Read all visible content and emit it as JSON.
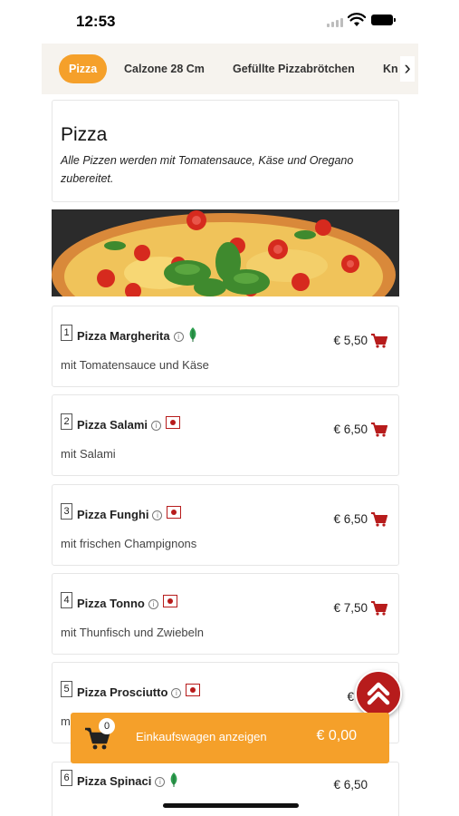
{
  "status_bar": {
    "time": "12:53"
  },
  "categories": {
    "items": [
      {
        "label": "Pizza",
        "active": true
      },
      {
        "label": "Calzone 28 Cm",
        "active": false
      },
      {
        "label": "Gefüllte Pizzabrötchen",
        "active": false
      },
      {
        "label": "Kn",
        "active": false
      }
    ]
  },
  "section": {
    "title": "Pizza",
    "description": "Alle Pizzen werden mit Tomatensauce, Käse und Oregano zubereitet."
  },
  "items": [
    {
      "number": "1",
      "name": "Pizza Margherita",
      "info": "i",
      "diet": "vegetarian",
      "price": "€ 5,50",
      "description": "mit Tomatensauce und Käse"
    },
    {
      "number": "2",
      "name": "Pizza Salami",
      "info": "i",
      "diet": "meat",
      "price": "€ 6,50",
      "description": "mit Salami"
    },
    {
      "number": "3",
      "name": "Pizza Funghi",
      "info": "i",
      "diet": "meat",
      "price": "€ 6,50",
      "description": "mit frischen Champignons"
    },
    {
      "number": "4",
      "name": "Pizza Tonno",
      "info": "i",
      "diet": "meat",
      "price": "€ 7,50",
      "description": "mit Thunfisch und Zwiebeln"
    },
    {
      "number": "5",
      "name": "Pizza Prosciutto",
      "info": "i",
      "diet": "meat",
      "price": "€ 6,",
      "description": "m"
    },
    {
      "number": "6",
      "name": "Pizza Spinaci",
      "info": "i",
      "diet": "vegetarian",
      "price": "€ 6,50",
      "description": ""
    }
  ],
  "cart_bar": {
    "count": "0",
    "label": "Einkaufswagen anzeigen",
    "total": "€ 0,00"
  },
  "colors": {
    "accent": "#f5a02a",
    "brand_red": "#b71c1c",
    "vegetarian_green": "#2e9e4f"
  },
  "icons": {
    "cart": "shopping-cart-icon",
    "scroll_top": "double-chevron-up-icon",
    "next": "chevron-right-icon",
    "info": "info-icon",
    "vegetarian": "leaf-icon",
    "meat": "meat-marker-icon"
  }
}
